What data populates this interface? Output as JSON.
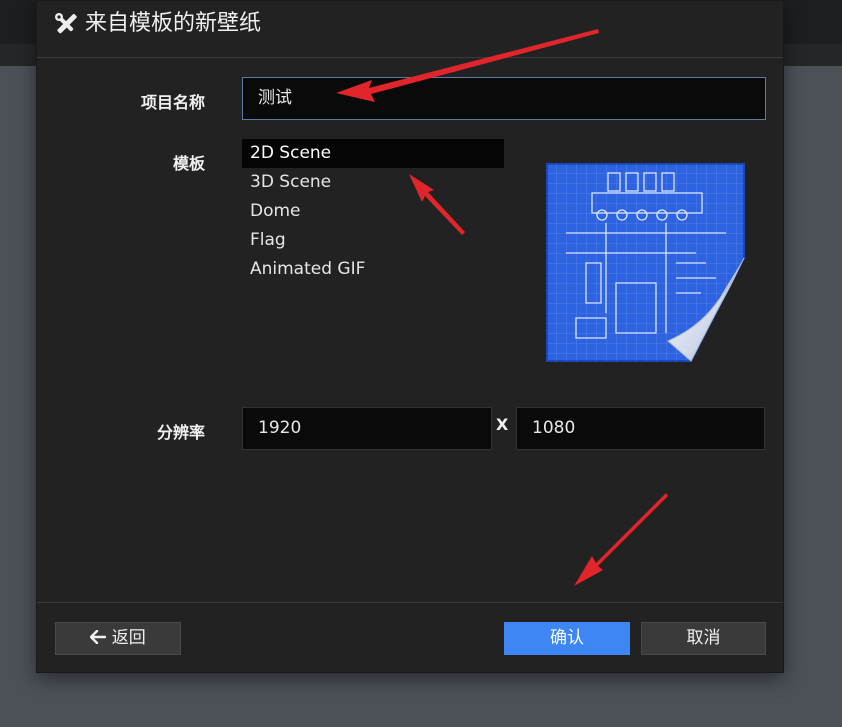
{
  "dialog": {
    "title": "来自模板的新壁纸",
    "title_icon": "tools-icon"
  },
  "form": {
    "name_label": "项目名称",
    "name_value": "测试",
    "template_label": "模板",
    "templates": [
      "2D Scene",
      "3D Scene",
      "Dome",
      "Flag",
      "Animated GIF"
    ],
    "selected_template": "2D Scene",
    "resolution_label": "分辨率",
    "width": "1920",
    "separator": "X",
    "height": "1080"
  },
  "footer": {
    "back_label": "返回",
    "back_icon": "arrow-left-icon",
    "confirm_label": "确认",
    "cancel_label": "取消"
  },
  "colors": {
    "accent": "#3d86f3",
    "annotation_arrow": "#e0262b"
  }
}
